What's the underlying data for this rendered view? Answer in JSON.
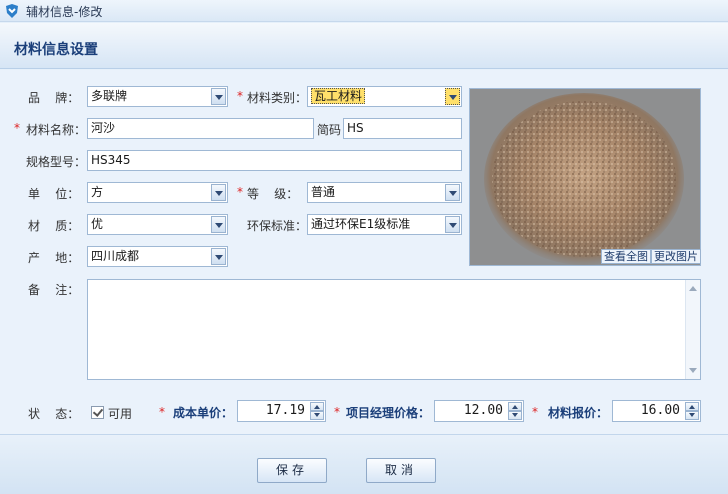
{
  "window": {
    "title": "辅材信息-修改",
    "icon": "app-shield-icon"
  },
  "header": {
    "title": "材料信息设置"
  },
  "form": {
    "brand": {
      "label": "品    牌：",
      "value": "多联牌"
    },
    "category": {
      "label": "材料类别：",
      "value": "瓦工材料"
    },
    "name": {
      "label": "材料名称：",
      "value": "河沙"
    },
    "code": {
      "label": "简码",
      "value": "HS"
    },
    "spec": {
      "label": "规格型号：",
      "value": "HS345"
    },
    "unit": {
      "label": "单    位：",
      "value": "方"
    },
    "grade": {
      "label": "等    级：",
      "value": "普通"
    },
    "quality": {
      "label": "材    质：",
      "value": "优"
    },
    "eco": {
      "label": "环保标准：",
      "value": "通过环保E1级标准"
    },
    "origin": {
      "label": "产    地：",
      "value": "四川成都"
    },
    "remark": {
      "label": "备    注：",
      "value": ""
    },
    "status": {
      "label": "状    态：",
      "checkbox_label": "可用",
      "checked": true
    }
  },
  "required_mark": "*",
  "photo": {
    "view_full_label": "查看全图",
    "change_label": "更改图片"
  },
  "pricing": {
    "cost": {
      "label": "成本单价：",
      "value": "17.19"
    },
    "pm": {
      "label": "项目经理价格：",
      "value": "12.00"
    },
    "quote": {
      "label": "材料报价：",
      "value": "16.00"
    }
  },
  "buttons": {
    "save": "保存",
    "cancel": "取消"
  }
}
